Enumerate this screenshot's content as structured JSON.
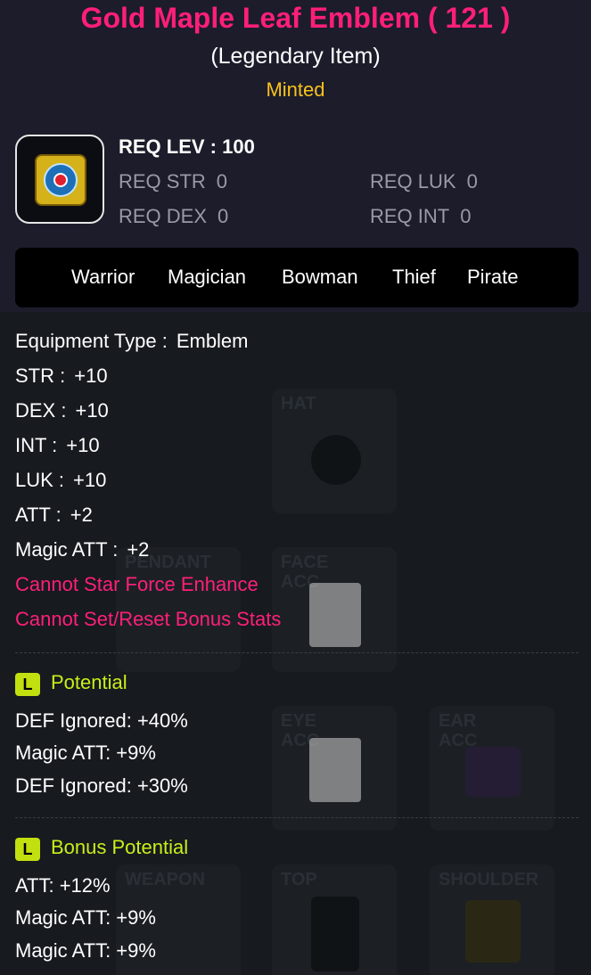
{
  "item": {
    "title": "Gold Maple Leaf Emblem ( 121 )",
    "rarity": "(Legendary Item)",
    "status": "Minted",
    "icon": "gold-maple-leaf-emblem-icon"
  },
  "requirements": {
    "level_label": "REQ LEV : 100",
    "str": {
      "label": "REQ STR",
      "value": "0"
    },
    "luk": {
      "label": "REQ LUK",
      "value": "0"
    },
    "dex": {
      "label": "REQ DEX",
      "value": "0"
    },
    "int": {
      "label": "REQ INT",
      "value": "0"
    }
  },
  "jobs": [
    "Warrior",
    "Magician",
    "Bowman",
    "Thief",
    "Pirate"
  ],
  "stats": [
    {
      "key": "Equipment Type :",
      "value": "Emblem"
    },
    {
      "key": "STR :",
      "value": "+10"
    },
    {
      "key": "DEX :",
      "value": "+10"
    },
    {
      "key": "INT :",
      "value": "+10"
    },
    {
      "key": "LUK :",
      "value": "+10"
    },
    {
      "key": "ATT :",
      "value": "+2"
    },
    {
      "key": "Magic ATT :",
      "value": "+2"
    }
  ],
  "warnings": [
    "Cannot Star Force Enhance",
    "Cannot Set/Reset Bonus Stats"
  ],
  "potential": {
    "badge": "L",
    "title": "Potential",
    "lines": [
      "DEF Ignored: +40%",
      "Magic ATT: +9%",
      "DEF Ignored: +30%"
    ]
  },
  "bonus_potential": {
    "badge": "L",
    "title": "Bonus Potential",
    "lines": [
      "ATT: +12%",
      "Magic ATT: +9%",
      "Magic ATT: +9%"
    ]
  },
  "backdrop_slots": [
    "HAT",
    "PENDANT",
    "FACE ACC",
    "EYE ACC",
    "EAR ACC",
    "WEAPON",
    "TOP",
    "SHOULDER"
  ],
  "colors": {
    "title": "#ff1f78",
    "minted": "#f8c21c",
    "warning": "#ff1f78",
    "potential": "#c9ef1a"
  }
}
